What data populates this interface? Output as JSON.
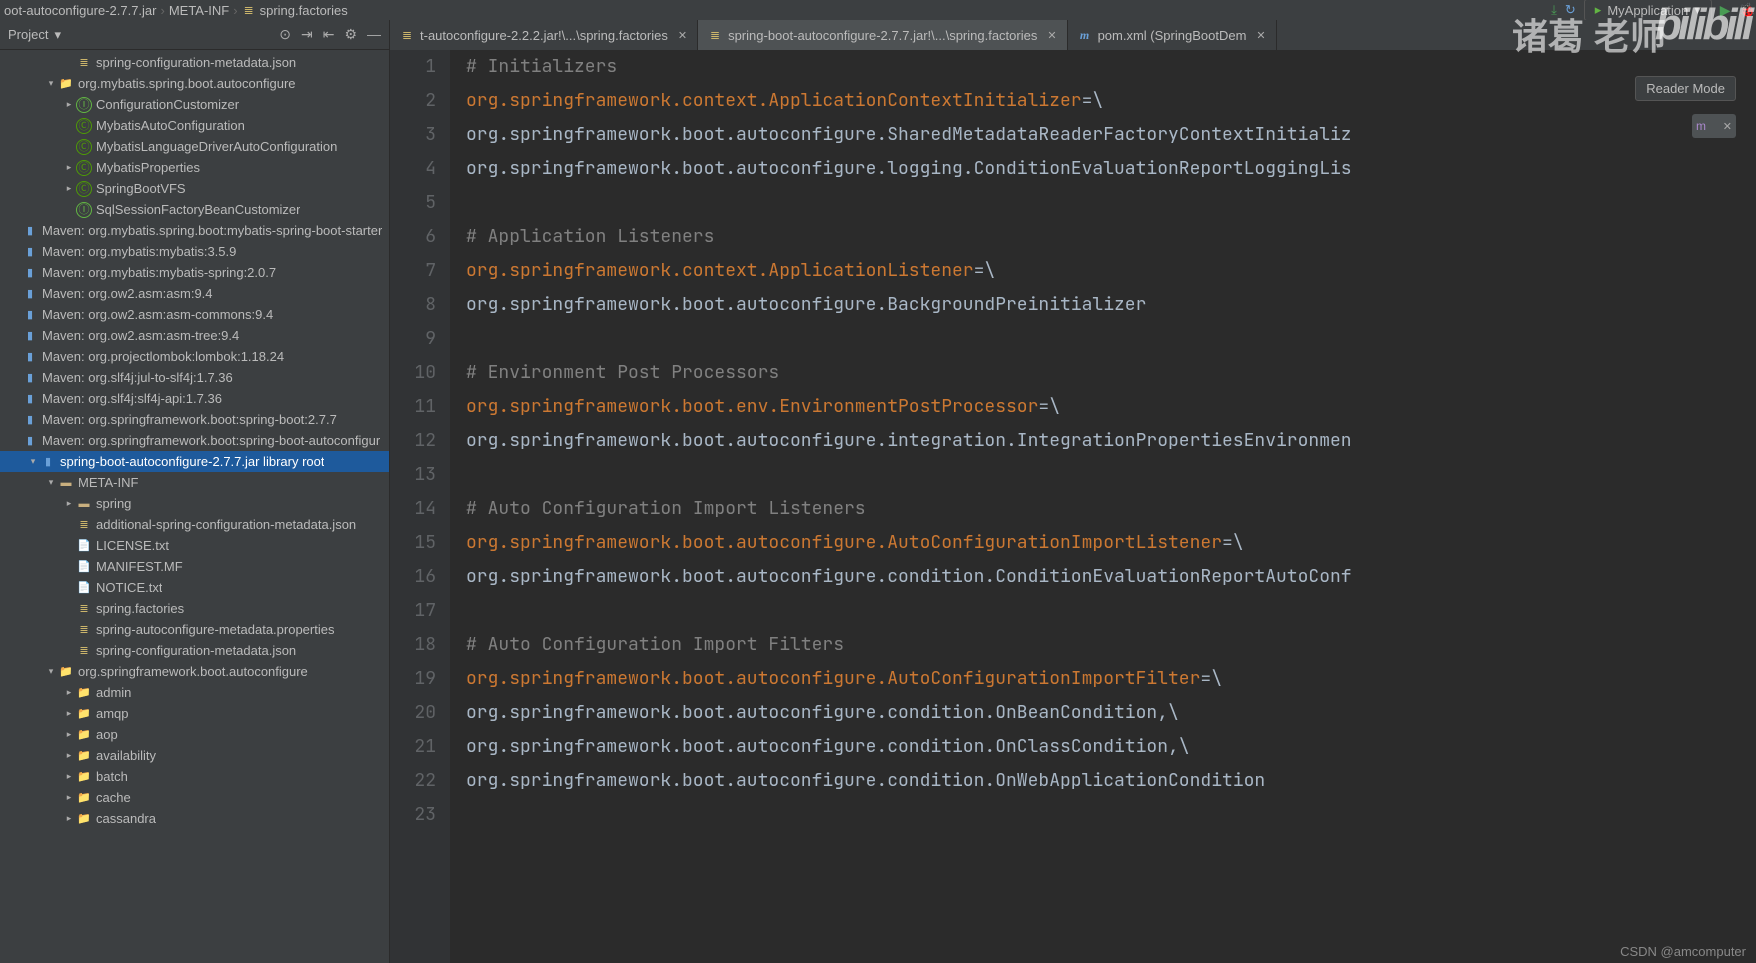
{
  "breadcrumbs": [
    "oot-autoconfigure-2.7.7.jar",
    "META-INF",
    "spring.factories"
  ],
  "run_config": "MyApplication",
  "sidebar_title": "Project",
  "reader_mode": "Reader Mode",
  "watermark_top": "诸葛 老师",
  "watermark_logo": "bilibili",
  "watermark_bottom": "CSDN @amcomputer",
  "tabs": [
    {
      "icon": "props",
      "label": "t-autoconfigure-2.2.2.jar!\\...\\spring.factories",
      "active": false
    },
    {
      "icon": "props",
      "label": "spring-boot-autoconfigure-2.7.7.jar!\\...\\spring.factories",
      "active": true
    },
    {
      "icon": "pom",
      "label": "pom.xml (SpringBootDem",
      "active": false
    }
  ],
  "tree": [
    {
      "indent": 3,
      "arrow": "",
      "icon": "json",
      "text": "spring-configuration-metadata.json"
    },
    {
      "indent": 2,
      "arrow": "▾",
      "icon": "pkg",
      "text": "org.mybatis.spring.boot.autoconfigure"
    },
    {
      "indent": 3,
      "arrow": "▸",
      "icon": "interface",
      "text": "ConfigurationCustomizer"
    },
    {
      "indent": 3,
      "arrow": "",
      "icon": "class",
      "text": "MybatisAutoConfiguration"
    },
    {
      "indent": 3,
      "arrow": "",
      "icon": "class",
      "text": "MybatisLanguageDriverAutoConfiguration"
    },
    {
      "indent": 3,
      "arrow": "▸",
      "icon": "class",
      "text": "MybatisProperties"
    },
    {
      "indent": 3,
      "arrow": "▸",
      "icon": "class",
      "text": "SpringBootVFS"
    },
    {
      "indent": 3,
      "arrow": "",
      "icon": "interface",
      "text": "SqlSessionFactoryBeanCustomizer"
    },
    {
      "indent": 0,
      "arrow": "",
      "icon": "lib",
      "text": "Maven: org.mybatis.spring.boot:mybatis-spring-boot-starter"
    },
    {
      "indent": 0,
      "arrow": "",
      "icon": "lib",
      "text": "Maven: org.mybatis:mybatis:3.5.9"
    },
    {
      "indent": 0,
      "arrow": "",
      "icon": "lib",
      "text": "Maven: org.mybatis:mybatis-spring:2.0.7"
    },
    {
      "indent": 0,
      "arrow": "",
      "icon": "lib",
      "text": "Maven: org.ow2.asm:asm:9.4"
    },
    {
      "indent": 0,
      "arrow": "",
      "icon": "lib",
      "text": "Maven: org.ow2.asm:asm-commons:9.4"
    },
    {
      "indent": 0,
      "arrow": "",
      "icon": "lib",
      "text": "Maven: org.ow2.asm:asm-tree:9.4"
    },
    {
      "indent": 0,
      "arrow": "",
      "icon": "lib",
      "text": "Maven: org.projectlombok:lombok:1.18.24"
    },
    {
      "indent": 0,
      "arrow": "",
      "icon": "lib",
      "text": "Maven: org.slf4j:jul-to-slf4j:1.7.36"
    },
    {
      "indent": 0,
      "arrow": "",
      "icon": "lib",
      "text": "Maven: org.slf4j:slf4j-api:1.7.36"
    },
    {
      "indent": 0,
      "arrow": "",
      "icon": "lib",
      "text": "Maven: org.springframework.boot:spring-boot:2.7.7"
    },
    {
      "indent": 0,
      "arrow": "",
      "icon": "lib",
      "text": "Maven: org.springframework.boot:spring-boot-autoconfigur"
    },
    {
      "indent": 1,
      "arrow": "▾",
      "icon": "lib",
      "text": "spring-boot-autoconfigure-2.7.7.jar  library root",
      "selected": true
    },
    {
      "indent": 2,
      "arrow": "▾",
      "icon": "folder",
      "text": "META-INF"
    },
    {
      "indent": 3,
      "arrow": "▸",
      "icon": "folder",
      "text": "spring"
    },
    {
      "indent": 3,
      "arrow": "",
      "icon": "json",
      "text": "additional-spring-configuration-metadata.json"
    },
    {
      "indent": 3,
      "arrow": "",
      "icon": "file",
      "text": "LICENSE.txt"
    },
    {
      "indent": 3,
      "arrow": "",
      "icon": "file",
      "text": "MANIFEST.MF"
    },
    {
      "indent": 3,
      "arrow": "",
      "icon": "file",
      "text": "NOTICE.txt"
    },
    {
      "indent": 3,
      "arrow": "",
      "icon": "json",
      "text": "spring.factories"
    },
    {
      "indent": 3,
      "arrow": "",
      "icon": "json",
      "text": "spring-autoconfigure-metadata.properties"
    },
    {
      "indent": 3,
      "arrow": "",
      "icon": "json",
      "text": "spring-configuration-metadata.json"
    },
    {
      "indent": 2,
      "arrow": "▾",
      "icon": "pkg",
      "text": "org.springframework.boot.autoconfigure"
    },
    {
      "indent": 3,
      "arrow": "▸",
      "icon": "pkg",
      "text": "admin"
    },
    {
      "indent": 3,
      "arrow": "▸",
      "icon": "pkg",
      "text": "amqp"
    },
    {
      "indent": 3,
      "arrow": "▸",
      "icon": "pkg",
      "text": "aop"
    },
    {
      "indent": 3,
      "arrow": "▸",
      "icon": "pkg",
      "text": "availability"
    },
    {
      "indent": 3,
      "arrow": "▸",
      "icon": "pkg",
      "text": "batch"
    },
    {
      "indent": 3,
      "arrow": "▸",
      "icon": "pkg",
      "text": "cache"
    },
    {
      "indent": 3,
      "arrow": "▸",
      "icon": "pkg",
      "text": "cassandra"
    }
  ],
  "code_lines": [
    {
      "n": 1,
      "segs": [
        {
          "c": "comment",
          "t": "# Initializers"
        }
      ]
    },
    {
      "n": 2,
      "segs": [
        {
          "c": "key-fqn",
          "t": "org.springframework.context.ApplicationContextInitializer"
        },
        {
          "c": "plain",
          "t": "=\\"
        }
      ]
    },
    {
      "n": 3,
      "segs": [
        {
          "c": "plain",
          "t": "org.springframework.boot.autoconfigure.SharedMetadataReaderFactoryContextInitializ"
        }
      ]
    },
    {
      "n": 4,
      "segs": [
        {
          "c": "plain",
          "t": "org.springframework.boot.autoconfigure.logging.ConditionEvaluationReportLoggingLis"
        }
      ]
    },
    {
      "n": 5,
      "segs": []
    },
    {
      "n": 6,
      "segs": [
        {
          "c": "comment",
          "t": "# Application Listeners"
        }
      ]
    },
    {
      "n": 7,
      "segs": [
        {
          "c": "key-fqn",
          "t": "org.springframework.context.ApplicationListener"
        },
        {
          "c": "plain",
          "t": "=\\"
        }
      ]
    },
    {
      "n": 8,
      "segs": [
        {
          "c": "plain",
          "t": "org.springframework.boot.autoconfigure.BackgroundPreinitializer"
        }
      ]
    },
    {
      "n": 9,
      "segs": []
    },
    {
      "n": 10,
      "segs": [
        {
          "c": "comment",
          "t": "# Environment Post Processors"
        }
      ]
    },
    {
      "n": 11,
      "segs": [
        {
          "c": "key-fqn",
          "t": "org.springframework.boot.env.EnvironmentPostProcessor"
        },
        {
          "c": "plain",
          "t": "=\\"
        }
      ]
    },
    {
      "n": 12,
      "segs": [
        {
          "c": "plain",
          "t": "org.springframework.boot.autoconfigure.integration.IntegrationPropertiesEnvironmen"
        }
      ]
    },
    {
      "n": 13,
      "segs": []
    },
    {
      "n": 14,
      "segs": [
        {
          "c": "comment",
          "t": "# Auto Configuration Import Listeners"
        }
      ]
    },
    {
      "n": 15,
      "segs": [
        {
          "c": "key-fqn",
          "t": "org.springframework.boot.autoconfigure.AutoConfigurationImportListener"
        },
        {
          "c": "plain",
          "t": "=\\"
        }
      ]
    },
    {
      "n": 16,
      "segs": [
        {
          "c": "plain",
          "t": "org.springframework.boot.autoconfigure.condition.ConditionEvaluationReportAutoConf"
        }
      ]
    },
    {
      "n": 17,
      "segs": []
    },
    {
      "n": 18,
      "segs": [
        {
          "c": "comment",
          "t": "# Auto Configuration Import Filters"
        }
      ]
    },
    {
      "n": 19,
      "segs": [
        {
          "c": "key-fqn",
          "t": "org.springframework.boot.autoconfigure.AutoConfigurationImportFilter"
        },
        {
          "c": "plain",
          "t": "=\\"
        }
      ]
    },
    {
      "n": 20,
      "segs": [
        {
          "c": "plain",
          "t": "org.springframework.boot.autoconfigure.condition.OnBeanCondition,\\"
        }
      ]
    },
    {
      "n": 21,
      "segs": [
        {
          "c": "plain",
          "t": "org.springframework.boot.autoconfigure.condition.OnClassCondition,\\"
        }
      ]
    },
    {
      "n": 22,
      "segs": [
        {
          "c": "plain",
          "t": "org.springframework.boot.autoconfigure.condition.OnWebApplicationCondition"
        }
      ]
    },
    {
      "n": 23,
      "segs": []
    }
  ]
}
